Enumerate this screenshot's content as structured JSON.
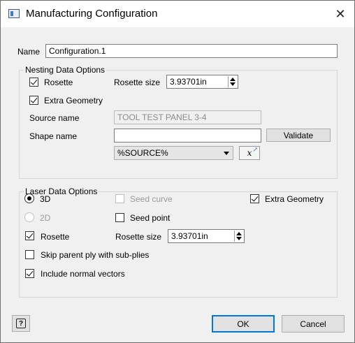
{
  "window": {
    "title": "Manufacturing Configuration",
    "close_symbol": "✕"
  },
  "name_row": {
    "label": "Name",
    "value": "Configuration.1"
  },
  "nesting": {
    "group_title": "Nesting Data Options",
    "rosette": {
      "label": "Rosette",
      "checked": true
    },
    "rosette_size": {
      "label": "Rosette size",
      "value": "3.93701in"
    },
    "extra_geometry": {
      "label": "Extra Geometry",
      "checked": true
    },
    "source_name": {
      "label": "Source name",
      "value": "TOOL TEST PANEL 3-4"
    },
    "shape_name": {
      "label": "Shape name",
      "value": ""
    },
    "validate_button": "Validate",
    "source_combo": "%SOURCE%",
    "formula_button": "𝑥"
  },
  "laser": {
    "group_title": "Laser Data Options",
    "radio_3d": {
      "label": "3D",
      "selected": true
    },
    "radio_2d": {
      "label": "2D",
      "selected": false
    },
    "seed_curve": {
      "label": "Seed curve",
      "checked": false
    },
    "seed_point": {
      "label": "Seed point",
      "checked": false
    },
    "extra_geometry": {
      "label": "Extra Geometry",
      "checked": true
    },
    "rosette": {
      "label": "Rosette",
      "checked": true
    },
    "rosette_size": {
      "label": "Rosette size",
      "value": "3.93701in"
    },
    "skip_parent": {
      "label": "Skip parent ply with sub-plies",
      "checked": false
    },
    "include_normals": {
      "label": "Include normal vectors",
      "checked": true
    }
  },
  "footer": {
    "help_icon": "?",
    "ok": "OK",
    "cancel": "Cancel"
  }
}
